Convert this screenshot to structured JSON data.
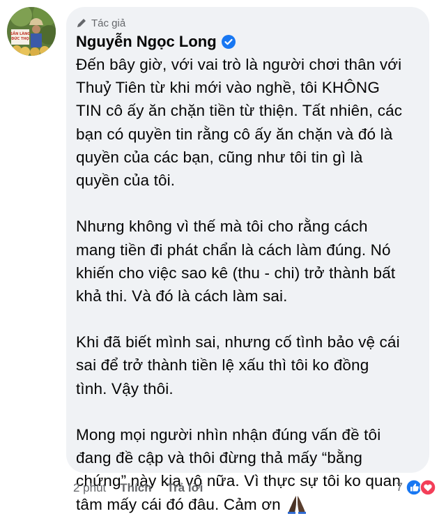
{
  "comment": {
    "author_badge": "Tác giả",
    "author_name": "Nguyễn Ngọc Long",
    "avatar_sign_text": "SẮN LÀNG ĐỨC THỌ",
    "paragraphs": [
      [
        "Đến bây giờ, với vai trò là người chơi thân với",
        "Thuỷ Tiên từ khi mới vào nghề, tôi KHÔNG",
        "TIN cô ấy ăn chặn tiền từ thiện. Tất nhiên, các",
        "bạn có quyền tin rằng cô ấy ăn chặn và đó là",
        "quyền của các bạn, cũng như tôi tin gì là",
        "quyền của tôi."
      ],
      [
        "Nhưng không vì thế mà tôi cho rằng cách",
        "mang tiền đi phát chẩn là cách làm đúng. Nó",
        "khiến cho việc sao kê (thu - chi) trở thành bất",
        "khả thi. Và đó là cách làm sai."
      ],
      [
        "Khi đã biết mình sai, nhưng cố tình bảo vệ cái",
        "sai để trở thành tiền lệ xấu thì tôi ko đồng",
        "tình. Vậy thôi."
      ],
      [
        "Mong mọi người nhìn nhận đúng vấn đề tôi",
        "đang đề cập và thôi đừng thả mấy “bằng",
        "chứng” này kia vô nữa. Vì thực sự tôi ko quan",
        "tâm mấy cái đó đâu. Cảm ơn"
      ]
    ],
    "actions": {
      "time": "2 phút",
      "like_label": "Thích",
      "reply_label": "Trả lời"
    },
    "reactions": {
      "count": "7",
      "icons": [
        "like-reaction-icon",
        "love-reaction-icon"
      ]
    }
  },
  "colors": {
    "bubble_bg": "#f0f2f5",
    "verified_blue": "#1877f2",
    "secondary_text": "#65676b",
    "love_red": "#f33e58"
  }
}
